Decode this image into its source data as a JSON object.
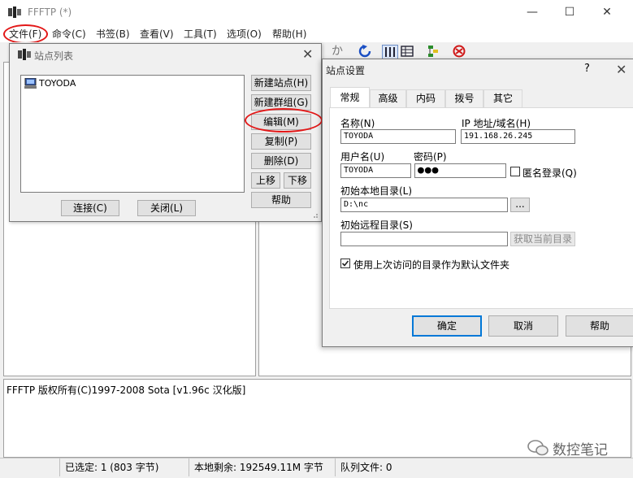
{
  "main": {
    "title": "FFFTP (*)",
    "menu": [
      "文件(F)",
      "命令(C)",
      "书签(B)",
      "查看(V)",
      "工具(T)",
      "选项(O)",
      "帮助(H)"
    ],
    "window_controls": {
      "minimize": "—",
      "maximize": "☐",
      "close": "✕"
    }
  },
  "toolbar": {
    "download_glyph": "か"
  },
  "log": {
    "text": "FFFTP 版权所有(C)1997-2008 Sota [v1.96c 汉化版]"
  },
  "status": {
    "selected": "已选定: 1 (803 字节)",
    "free_space": "本地剩余: 192549.11M 字节",
    "queue": "队列文件: 0"
  },
  "site_list": {
    "title": "站点列表",
    "close": "✕",
    "sites": [
      "TOYODA"
    ],
    "buttons": {
      "new_site": "新建站点(H)",
      "new_group": "新建群组(G)",
      "edit": "编辑(M)",
      "copy": "复制(P)",
      "delete": "删除(D)",
      "move_up": "上移",
      "move_down": "下移",
      "help": "帮助",
      "connect": "连接(C)",
      "close": "关闭(L)"
    }
  },
  "site_settings": {
    "title": "站点设置",
    "help_mark": "?",
    "close": "✕",
    "tabs": [
      "常规",
      "高级",
      "内码",
      "拨号",
      "其它"
    ],
    "labels": {
      "name": "名称(N)",
      "host": "IP 地址/域名(H)",
      "user": "用户名(U)",
      "password": "密码(P)",
      "anonymous": "匿名登录(Q)",
      "local_dir": "初始本地目录(L)",
      "remote_dir": "初始远程目录(S)",
      "use_last_dir": "使用上次访问的目录作为默认文件夹"
    },
    "values": {
      "name": "TOYODA",
      "host": "191.168.26.245",
      "user": "TOYODA",
      "password": "●●●",
      "local_dir": "D:\\nc",
      "remote_dir": ""
    },
    "buttons": {
      "browse": "...",
      "get_current": "获取当前目录",
      "ok": "确定",
      "cancel": "取消",
      "help": "帮助"
    }
  },
  "watermark": {
    "text": "数控笔记"
  },
  "colors": {
    "highlight": "#e31818",
    "accent": "#0078d7"
  }
}
